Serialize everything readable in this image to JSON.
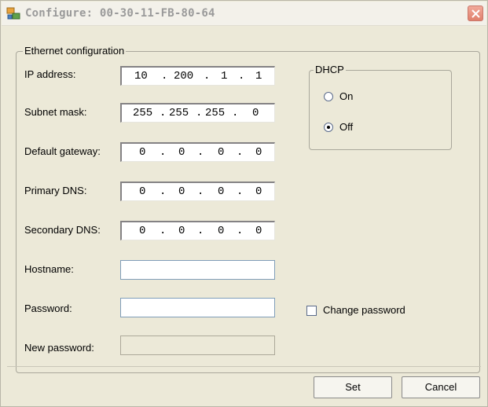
{
  "window": {
    "title": "Configure: 00-30-11-FB-80-64"
  },
  "ethernet": {
    "group_label": "Ethernet configuration",
    "fields": [
      {
        "label": "IP address:",
        "octets": [
          "10",
          "200",
          "1",
          "1"
        ]
      },
      {
        "label": "Subnet mask:",
        "octets": [
          "255",
          "255",
          "255",
          "0"
        ]
      },
      {
        "label": "Default gateway:",
        "octets": [
          "0",
          "0",
          "0",
          "0"
        ]
      },
      {
        "label": "Primary DNS:",
        "octets": [
          "0",
          "0",
          "0",
          "0"
        ]
      },
      {
        "label": "Secondary DNS:",
        "octets": [
          "0",
          "0",
          "0",
          "0"
        ]
      }
    ],
    "hostname": {
      "label": "Hostname:",
      "value": ""
    },
    "password": {
      "label": "Password:",
      "value": ""
    },
    "new_password": {
      "label": "New password:",
      "value": "",
      "disabled": true
    },
    "change_password": {
      "label": "Change password",
      "checked": false
    }
  },
  "dhcp": {
    "group_label": "DHCP",
    "on_label": "On",
    "off_label": "Off",
    "selected": "Off"
  },
  "buttons": {
    "set": "Set",
    "cancel": "Cancel"
  }
}
